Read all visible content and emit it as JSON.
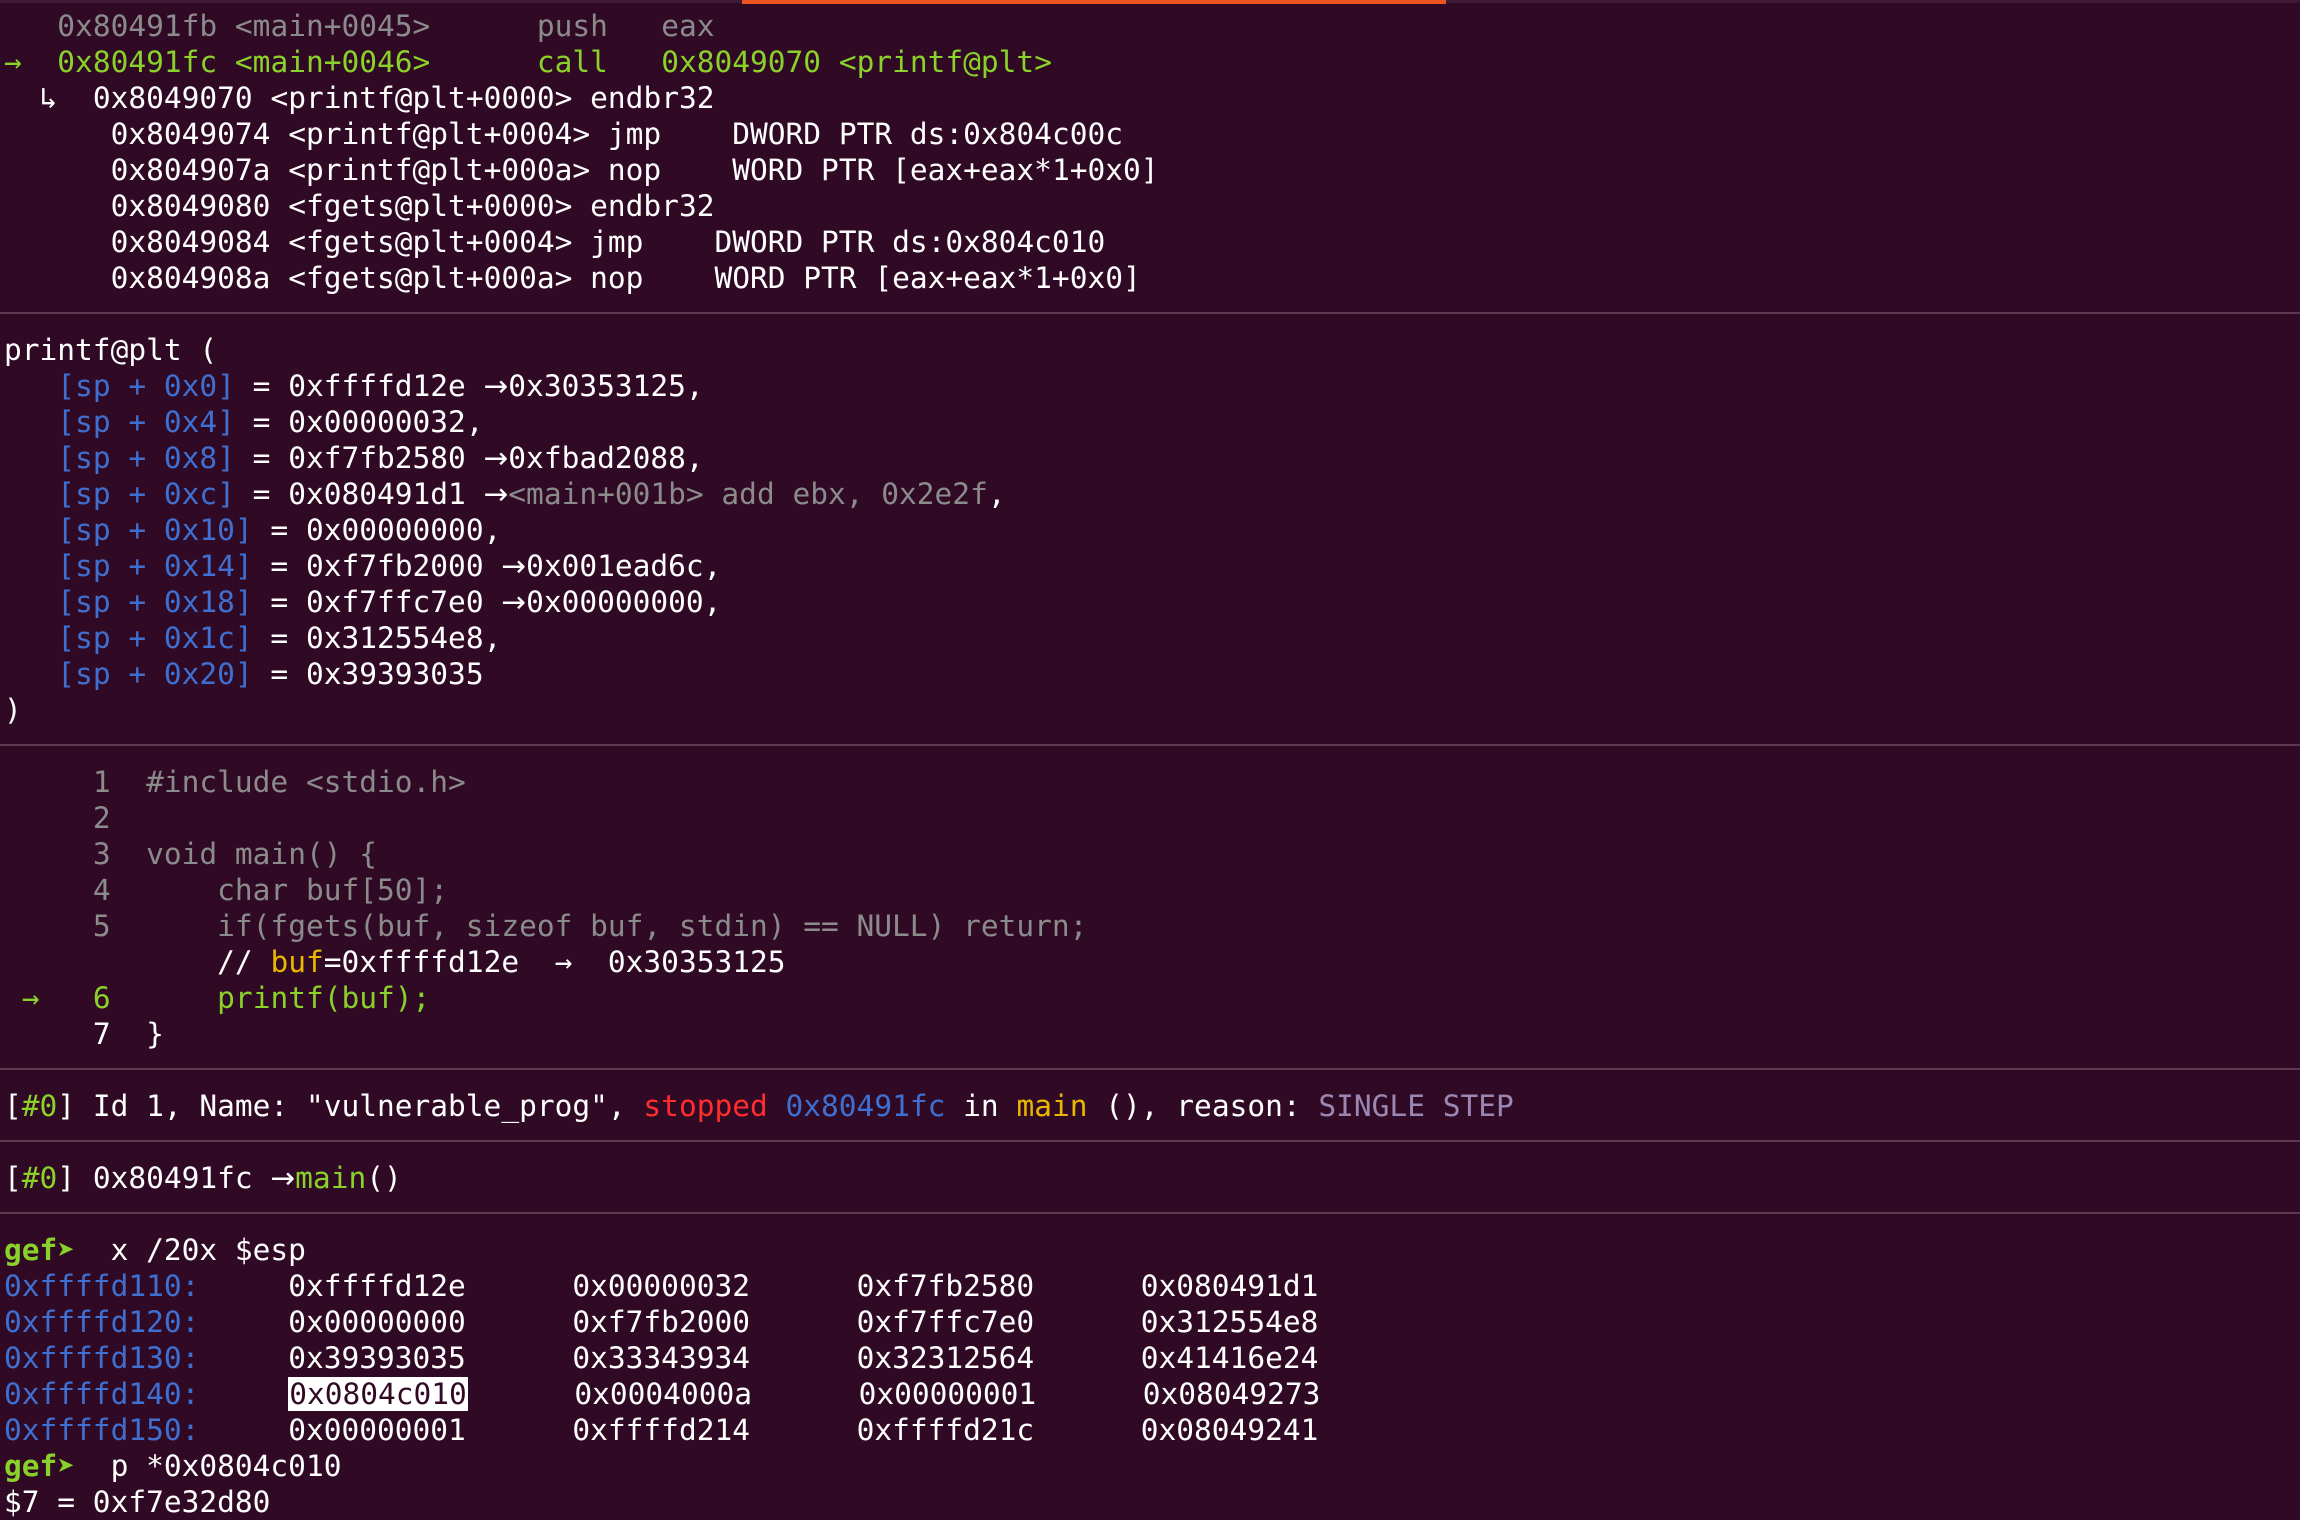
{
  "disasm": {
    "prev": {
      "addr": "0x80491fb",
      "sym": "<main+0045>",
      "op": "push",
      "args": "eax"
    },
    "current": {
      "arrow": "→",
      "addr": "0x80491fc",
      "sym": "<main+0046>",
      "op": "call",
      "target": "0x8049070 <printf@plt>"
    },
    "sub_marker": "↳",
    "sub": [
      {
        "addr": "0x8049070",
        "sym": "<printf@plt+0000>",
        "op": "endbr32",
        "args": ""
      },
      {
        "addr": "0x8049074",
        "sym": "<printf@plt+0004>",
        "op": "jmp",
        "args": "DWORD PTR ds:0x804c00c"
      },
      {
        "addr": "0x804907a",
        "sym": "<printf@plt+000a>",
        "op": "nop",
        "args": "WORD PTR [eax+eax*1+0x0]"
      },
      {
        "addr": "0x8049080",
        "sym": "<fgets@plt+0000>",
        "op": "endbr32",
        "args": ""
      },
      {
        "addr": "0x8049084",
        "sym": "<fgets@plt+0004>",
        "op": "jmp",
        "args": "DWORD PTR ds:0x804c010"
      },
      {
        "addr": "0x804908a",
        "sym": "<fgets@plt+000a>",
        "op": "nop",
        "args": "WORD PTR [eax+eax*1+0x0]"
      }
    ]
  },
  "args": {
    "header": "printf@plt (",
    "items": [
      {
        "slot": "[sp + 0x0]",
        "value": "0xffffd12e",
        "arrow": "→",
        "deref": "0x30353125,",
        "deref_gray": false,
        "tail": ""
      },
      {
        "slot": "[sp + 0x4]",
        "value": "0x00000032,",
        "arrow": "",
        "deref": "",
        "deref_gray": false,
        "tail": ""
      },
      {
        "slot": "[sp + 0x8]",
        "value": "0xf7fb2580",
        "arrow": "→",
        "deref": "0xfbad2088,",
        "deref_gray": false,
        "tail": ""
      },
      {
        "slot": "[sp + 0xc]",
        "value": "0x080491d1",
        "arrow": "→",
        "deref": "<main+001b> add ebx, 0x2e2f",
        "deref_gray": true,
        "tail": ","
      },
      {
        "slot": "[sp + 0x10]",
        "value": "0x00000000,",
        "arrow": "",
        "deref": "",
        "deref_gray": false,
        "tail": ""
      },
      {
        "slot": "[sp + 0x14]",
        "value": "0xf7fb2000",
        "arrow": "→",
        "deref": "0x001ead6c,",
        "deref_gray": false,
        "tail": ""
      },
      {
        "slot": "[sp + 0x18]",
        "value": "0xf7ffc7e0",
        "arrow": "→",
        "deref": "0x00000000,",
        "deref_gray": false,
        "tail": ""
      },
      {
        "slot": "[sp + 0x1c]",
        "value": "0x312554e8,",
        "arrow": "",
        "deref": "",
        "deref_gray": false,
        "tail": ""
      },
      {
        "slot": "[sp + 0x20]",
        "value": "0x39393035",
        "arrow": "",
        "deref": "",
        "deref_gray": false,
        "tail": ""
      }
    ],
    "footer": ")"
  },
  "source": {
    "lines": [
      {
        "num": "1",
        "code": "#include <stdio.h>"
      },
      {
        "num": "2",
        "code": ""
      },
      {
        "num": "3",
        "code": "void main() {"
      },
      {
        "num": "4",
        "code": "    char buf[50];"
      },
      {
        "num": "5",
        "code": "    if(fgets(buf, sizeof buf, stdin) == NULL) return;"
      }
    ],
    "comment": {
      "prefix": "// ",
      "var": "buf",
      "rest": "=0xffffd12e  →  0x30353125"
    },
    "current": {
      "arrow": "→",
      "num": "6",
      "code": "printf(buf);"
    },
    "last": {
      "num": "7",
      "code": "}"
    }
  },
  "threads": {
    "tag": "#0",
    "pre": "Id 1, Name: \"vulnerable_prog\",",
    "status": "stopped",
    "addr": "0x80491fc",
    "in_word": "in",
    "func": "main",
    "post": "(), reason:",
    "reason": "SINGLE STEP"
  },
  "trace": {
    "tag": "#0",
    "addr": "0x80491fc",
    "arrow": "→",
    "func": "main",
    "suffix": "()"
  },
  "console": {
    "prompt": "gef➤",
    "cmd1": "x /20x $esp",
    "rows": [
      {
        "addr": "0xffffd110:",
        "vals": [
          "0xffffd12e",
          "0x00000032",
          "0xf7fb2580",
          "0x080491d1"
        ]
      },
      {
        "addr": "0xffffd120:",
        "vals": [
          "0x00000000",
          "0xf7fb2000",
          "0xf7ffc7e0",
          "0x312554e8"
        ]
      },
      {
        "addr": "0xffffd130:",
        "vals": [
          "0x39393035",
          "0x33343934",
          "0x32312564",
          "0x41416e24"
        ]
      },
      {
        "addr": "0xffffd140:",
        "vals": [
          "0x0804c010",
          "0x0004000a",
          "0x00000001",
          "0x08049273"
        ]
      },
      {
        "addr": "0xffffd150:",
        "vals": [
          "0x00000001",
          "0xffffd214",
          "0xffffd21c",
          "0x08049241"
        ]
      }
    ],
    "cmd2": "p *0x0804c010",
    "result": "$7 = 0xf7e32d80"
  },
  "colors": {
    "background": "#300a24",
    "green": "#8ad22a",
    "blue": "#3f6fd1",
    "gold": "#eab700",
    "red": "#ff2d2d",
    "gray": "#8b8b8b",
    "accent": "#e95420"
  }
}
